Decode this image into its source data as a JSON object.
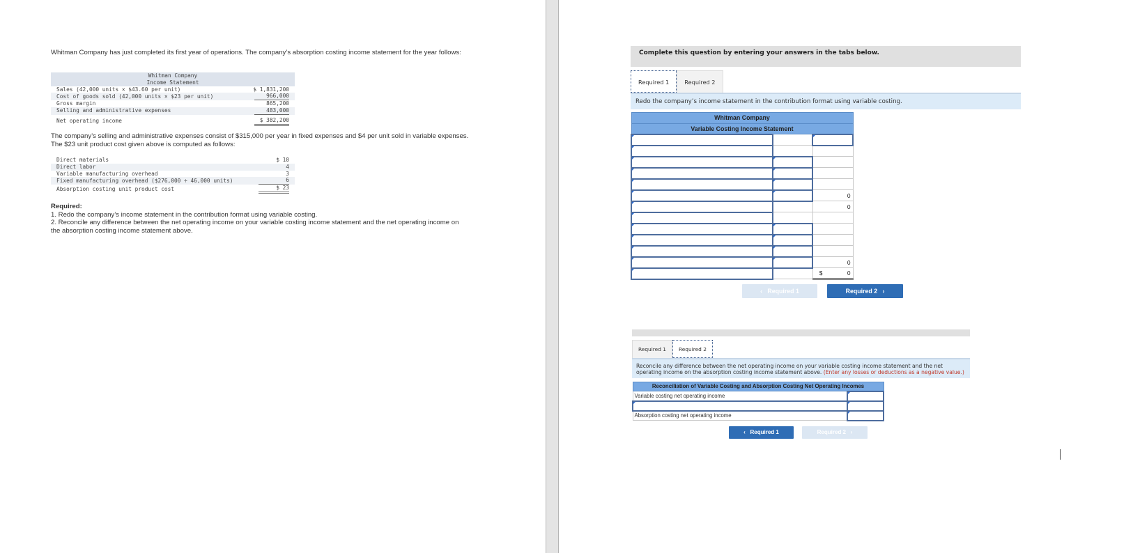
{
  "problem": {
    "intro": "Whitman Company has just completed its first year of operations. The company’s absorption costing income statement for the year follows:",
    "income_statement": {
      "title_line1": "Whitman Company",
      "title_line2": "Income Statement",
      "rows": [
        {
          "label": "Sales (42,000 units × $43.60 per unit)",
          "amount": "$ 1,831,200"
        },
        {
          "label": "Cost of goods sold (42,000 units × $23 per unit)",
          "amount": "966,000"
        },
        {
          "label": "Gross margin",
          "amount": "865,200"
        },
        {
          "label": "Selling and administrative expenses",
          "amount": "483,000"
        },
        {
          "label": "Net operating income",
          "amount": "$ 382,200"
        }
      ]
    },
    "text2": "The company’s selling and administrative expenses consist of $315,000 per year in fixed expenses and $4 per unit sold in variable expenses. The $23 unit product cost given above is computed as follows:",
    "unit_cost": {
      "rows": [
        {
          "label": "Direct materials",
          "amount": "$ 10"
        },
        {
          "label": "Direct labor",
          "amount": "4"
        },
        {
          "label": "Variable manufacturing overhead",
          "amount": "3"
        },
        {
          "label": "Fixed manufacturing overhead ($276,000 ÷ 46,000 units)",
          "amount": "6"
        },
        {
          "label": "Absorption costing unit product cost",
          "amount": "$ 23"
        }
      ]
    },
    "required_heading": "Required:",
    "required_1": "1. Redo the company’s income statement in the contribution format using variable costing.",
    "required_2": "2. Reconcile any difference between the net operating income on your variable costing income statement and the net operating income on the absorption costing income statement above."
  },
  "answer": {
    "banner": "Complete this question by entering your answers in the tabs below.",
    "tabs": [
      {
        "label": "Required 1"
      },
      {
        "label": "Required 2"
      }
    ],
    "instruction_1": "Redo the company’s income statement in the contribution format using variable costing.",
    "vc_statement": {
      "title_line1": "Whitman Company",
      "title_line2": "Variable Costing Income Statement",
      "computed_values": {
        "row6_total": "0",
        "row7_total": "0",
        "row12_total": "0",
        "row13_dollar": "$",
        "row13_total": "0"
      }
    },
    "nav1": {
      "prev_label": "Required 1",
      "next_label": "Required 2"
    },
    "instruction_2": "Reconcile any difference between the net operating income on your variable costing income statement and the net operating income on the absorption costing income statement above.",
    "instruction_2_note": "(Enter any losses or deductions as a negative value.)",
    "reconciliation": {
      "title": "Reconciliation of Variable Costing and Absorption Costing Net Operating Incomes",
      "row1_label": "Variable costing net operating income",
      "row3_label": "Absorption costing net operating income"
    },
    "nav2": {
      "prev_label": "Required 1",
      "next_label": "Required 2"
    }
  },
  "icons": {
    "chevron_left": "‹",
    "chevron_right": "›"
  }
}
